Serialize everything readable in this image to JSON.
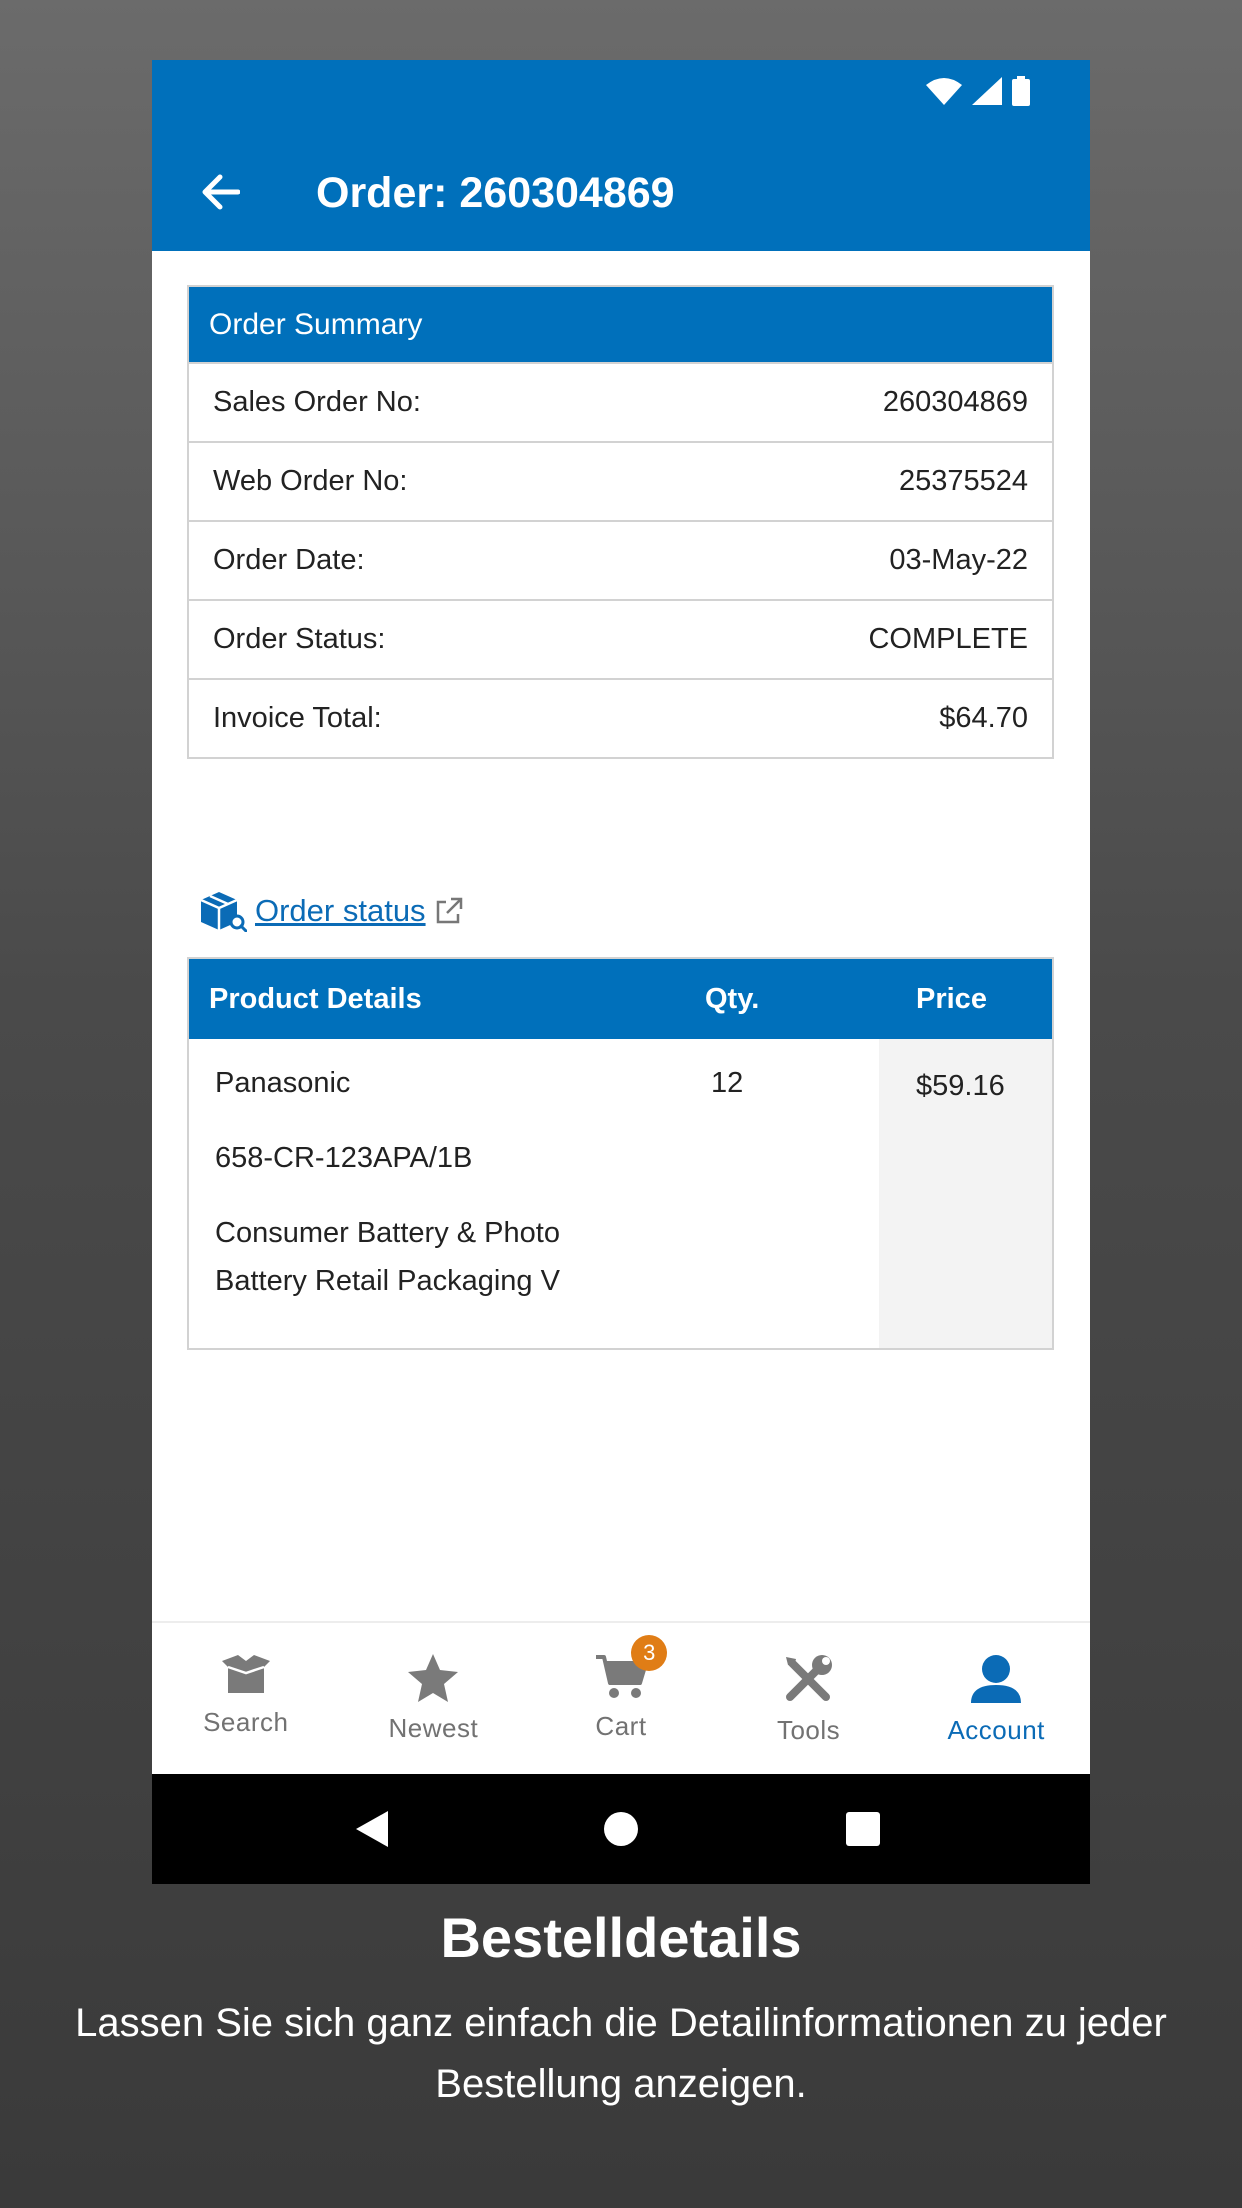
{
  "appbar": {
    "title": "Order: 260304869",
    "color": "#0070bb"
  },
  "status_bar": {
    "icons": [
      "wifi-icon",
      "signal-icon",
      "battery-icon"
    ]
  },
  "summary": {
    "heading": "Order Summary",
    "rows": [
      {
        "label": "Sales Order No:",
        "value": "260304869"
      },
      {
        "label": "Web Order No:",
        "value": "25375524"
      },
      {
        "label": "Order Date:",
        "value": "03-May-22"
      },
      {
        "label": "Order Status:",
        "value": "COMPLETE"
      },
      {
        "label": "Invoice Total:",
        "value": "$64.70"
      }
    ]
  },
  "order_status_link": {
    "label": "Order status",
    "icon": "package-search-icon",
    "trailing_icon": "external-link-icon"
  },
  "products": {
    "headers": {
      "details": "Product Details",
      "qty": "Qty.",
      "price": "Price"
    },
    "item": {
      "manufacturer": "Panasonic",
      "part_number": "658-CR-123APA/1B",
      "description_line1": "Consumer Battery & Photo",
      "description_line2": "Battery Retail Packaging V",
      "qty": "12",
      "price": "$59.16"
    }
  },
  "bottom_nav": {
    "items": [
      {
        "label": "Search",
        "icon": "box-icon"
      },
      {
        "label": "Newest",
        "icon": "star-icon"
      },
      {
        "label": "Cart",
        "icon": "cart-icon",
        "badge": "3"
      },
      {
        "label": "Tools",
        "icon": "tools-icon"
      },
      {
        "label": "Account",
        "icon": "account-icon",
        "active": true
      }
    ],
    "active_color": "#0b6bb6",
    "badge_color": "#e07d16"
  },
  "caption": {
    "title": "Bestelldetails",
    "body": "Lassen Sie sich ganz einfach die Detailinformationen zu jeder Bestellung anzeigen."
  }
}
